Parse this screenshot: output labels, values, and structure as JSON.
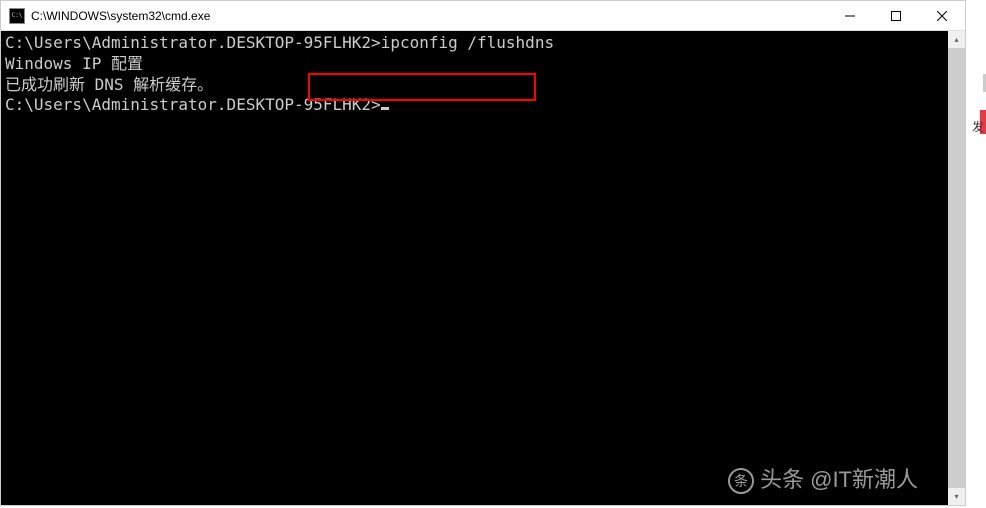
{
  "titlebar": {
    "title": "C:\\WINDOWS\\system32\\cmd.exe"
  },
  "terminal": {
    "blank_top": "",
    "line1_prompt": "C:\\Users\\Administrator.DESKTOP-95FLHK2>",
    "line1_command": "ipconfig /flushdns",
    "blank1": "",
    "line2": "Windows IP 配置",
    "blank2": "",
    "line3": "已成功刷新 DNS 解析缓存。",
    "blank3": "",
    "line4_prompt": "C:\\Users\\Administrator.DESKTOP-95FLHK2>"
  },
  "watermark": {
    "source": "头条",
    "author": "@IT新潮人"
  },
  "partial_text": "发"
}
